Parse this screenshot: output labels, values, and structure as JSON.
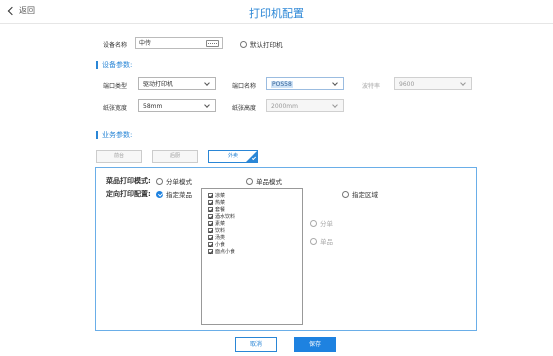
{
  "header": {
    "back_label": "返回",
    "title": "打印机配置"
  },
  "device": {
    "name_label": "设备名称",
    "name_value": "中传",
    "default_printer_label": "默认打印机"
  },
  "device_params": {
    "section_title": "设备参数:",
    "port_type_label": "端口类型",
    "port_type_value": "驱动打印机",
    "port_name_label": "端口名称",
    "port_name_value": "POS58",
    "baud_label": "波特率",
    "baud_value": "9600",
    "paper_width_label": "纸张宽度",
    "paper_width_value": "58mm",
    "paper_height_label": "纸张高度",
    "paper_height_value": "2000mm"
  },
  "business_params": {
    "section_title": "业务参数:",
    "tabs": [
      {
        "label": "前台",
        "active": false
      },
      {
        "label": "后厨",
        "active": false
      },
      {
        "label": "外卖",
        "active": true
      }
    ]
  },
  "panel": {
    "print_mode_label": "菜品打印模式:",
    "mode_split_label": "分单模式",
    "mode_single_label": "单品模式",
    "directed_label": "定向打印配置:",
    "specify_dish_label": "指定菜品",
    "specify_area_label": "指定区域",
    "area_split_label": "分单",
    "area_single_label": "单品",
    "dishes": [
      "凉菜",
      "热菜",
      "套餐",
      "酒水饮料",
      "素菜",
      "饮料",
      "汤类",
      "小食",
      "面点小食"
    ]
  },
  "footer": {
    "cancel_label": "取消",
    "save_label": "保存"
  },
  "colors": {
    "accent": "#1e82e0",
    "title": "#2a86d6",
    "panel_border": "#6aaee8"
  }
}
